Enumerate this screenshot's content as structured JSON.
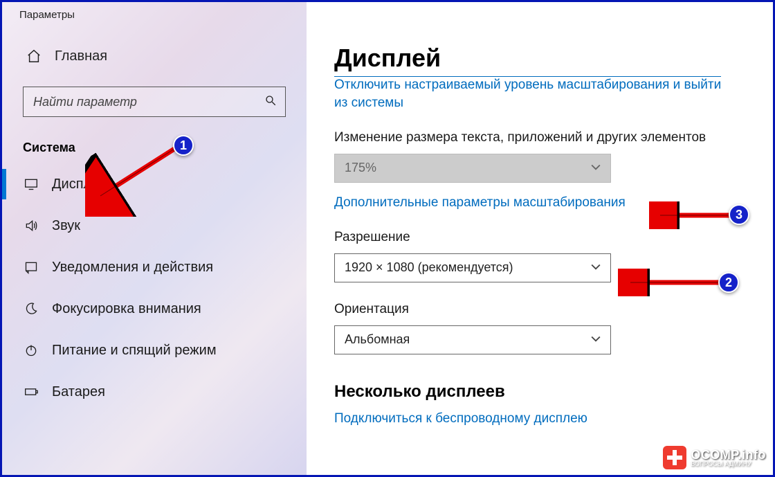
{
  "title_bar": "Параметры",
  "home_label": "Главная",
  "search": {
    "placeholder": "Найти параметр"
  },
  "section_label": "Система",
  "nav": {
    "display": {
      "label": "Дисплей"
    },
    "sound": {
      "label": "Звук"
    },
    "notif": {
      "label": "Уведомления и действия"
    },
    "focus": {
      "label": "Фокусировка внимания"
    },
    "power": {
      "label": "Питание и спящий режим"
    },
    "battery": {
      "label": "Батарея"
    }
  },
  "main": {
    "title": "Дисплей",
    "trunc_link_top": "Отключить настраиваемый уровень масштабирования и выйти",
    "trunc_link_bot": "из системы",
    "scale_label": "Изменение размера текста, приложений и других элементов",
    "scale_value": "175%",
    "scale_adv_link": "Дополнительные параметры масштабирования",
    "res_label": "Разрешение",
    "res_value": "1920 × 1080 (рекомендуется)",
    "orient_label": "Ориентация",
    "orient_value": "Альбомная",
    "multi_header": "Несколько дисплеев",
    "wireless_link": "Подключиться к беспроводному дисплею"
  },
  "markers": {
    "m1": "1",
    "m2": "2",
    "m3": "3"
  },
  "logo": {
    "t1": "OCOMP.info",
    "t2": "ВОПРОСЫ АДМИНУ"
  }
}
